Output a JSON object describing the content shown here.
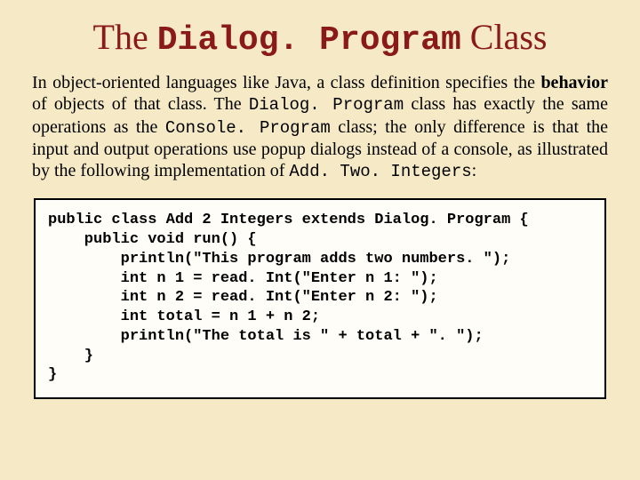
{
  "title": {
    "pre": "The ",
    "mono": "Dialog. Program",
    "post": " Class"
  },
  "body": {
    "t1": "In object-oriented languages like Java, a class definition specifies the ",
    "b1": "behavior",
    "t2": " of objects of that class.  The ",
    "m1": "Dialog. Program",
    "t3": " class has exactly the same operations as the ",
    "m2": "Console. Program",
    "t4": " class; the only difference is that the input and output operations use popup dialogs instead of a console, as illustrated by the following implementation of ",
    "m3": "Add. Two. Integers",
    "t5": ":"
  },
  "code": "public class Add 2 Integers extends Dialog. Program {\n    public void run() {\n        println(\"This program adds two numbers. \");\n        int n 1 = read. Int(\"Enter n 1: \");\n        int n 2 = read. Int(\"Enter n 2: \");\n        int total = n 1 + n 2;\n        println(\"The total is \" + total + \". \");\n    }\n}"
}
